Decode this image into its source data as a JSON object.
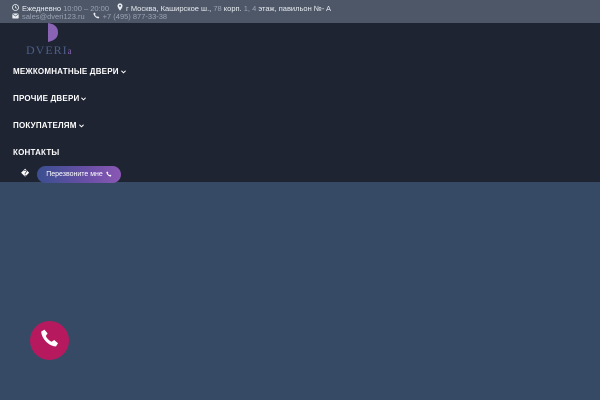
{
  "topbar": {
    "hours_label": "Ежедневно",
    "hours_value": "10:00 – 20:00",
    "address_main": "г Москва, Каширское ш.,",
    "address_num": "78",
    "address_corp": "корп.",
    "address_corp_num": "1, 4",
    "address_rest": "этаж, павильон №",
    "address_tail": "- A",
    "email": "sales@dveri123.ru",
    "phone": "+7 (495) 877-33-38"
  },
  "logo": {
    "text": "DVERI",
    "sub": "a"
  },
  "nav": {
    "items": [
      {
        "label": "МЕЖКОМНАТНЫЕ ДВЕРИ"
      },
      {
        "label": "ПРОЧИЕ ДВЕРИ"
      },
      {
        "label": "ПОКУПАТЕЛЯМ"
      },
      {
        "label": "КОНТАКТЫ"
      }
    ]
  },
  "misc": {
    "glyph": "�"
  },
  "callback": {
    "label": "Перезвоните мне"
  },
  "colors": {
    "topbar": "#4d5768",
    "header": "#1f2433",
    "page": "#364a66",
    "accent_purple": "#8a58b4",
    "fab": "#b7195f"
  },
  "icons": {
    "hours": "clock-icon",
    "address": "map-pin-icon",
    "email": "envelope-icon",
    "phone": "phone-icon",
    "chevron": "chevron-down-icon"
  }
}
